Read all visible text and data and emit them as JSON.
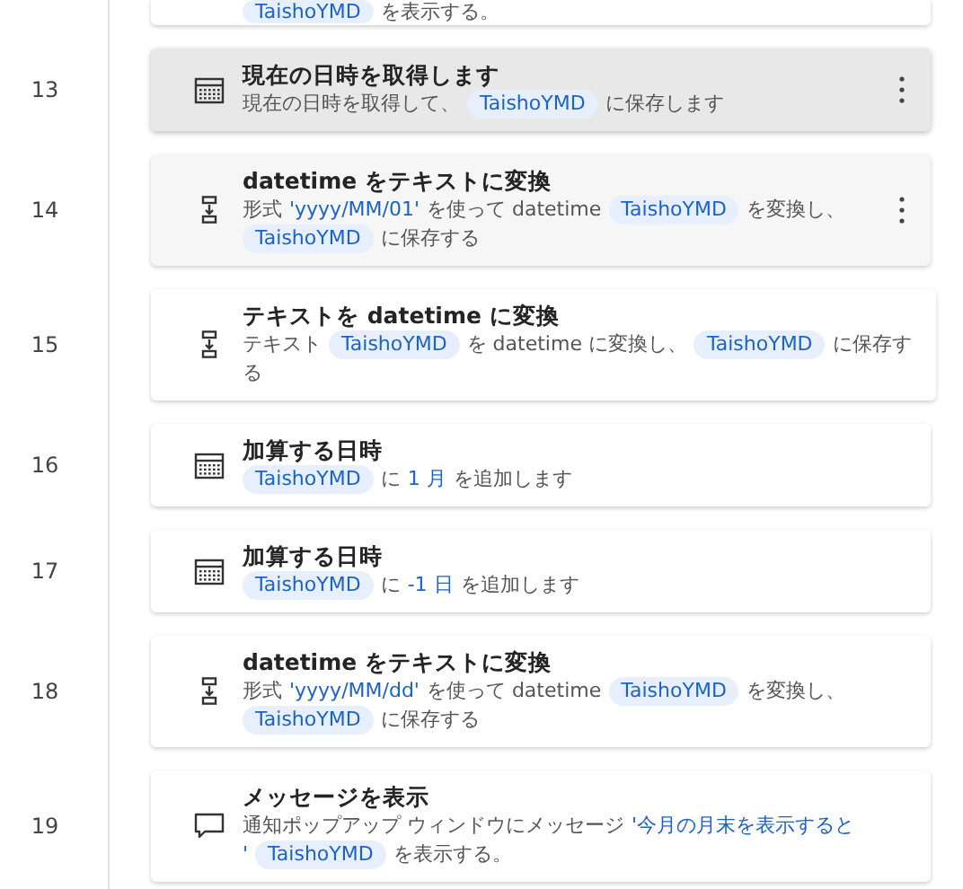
{
  "steps": [
    {
      "kind": "partial",
      "selected": false,
      "hovered": false,
      "lines": [
        [
          {
            "kind": "var",
            "text": "TaishoYMD"
          },
          {
            "kind": "text",
            "text": "を表示する。"
          }
        ]
      ]
    },
    {
      "number": "13",
      "title": "現在の日時を取得します",
      "kind": "calendar",
      "selected": true,
      "hovered": false,
      "lines": [
        [
          {
            "kind": "text",
            "text": "現在の日時を取得して、"
          },
          {
            "kind": "var",
            "text": "TaishoYMD"
          },
          {
            "kind": "text",
            "text": "に保存します"
          }
        ]
      ]
    },
    {
      "number": "14",
      "title": "datetime をテキストに変換",
      "kind": "convert",
      "selected": false,
      "hovered": true,
      "lines": [
        [
          {
            "kind": "text",
            "text": "形式"
          },
          {
            "kind": "literal",
            "text": "'yyyy/MM/01'"
          },
          {
            "kind": "text",
            "text": "を使って datetime"
          },
          {
            "kind": "var",
            "text": "TaishoYMD"
          },
          {
            "kind": "text",
            "text": "を変換し、"
          }
        ],
        [
          {
            "kind": "var",
            "text": "TaishoYMD"
          },
          {
            "kind": "text",
            "text": "に保存する"
          }
        ]
      ]
    },
    {
      "number": "15",
      "title": "テキストを datetime に変換",
      "kind": "convert",
      "selected": false,
      "hovered": false,
      "lines": [
        [
          {
            "kind": "text",
            "text": "テキスト"
          },
          {
            "kind": "var",
            "text": "TaishoYMD"
          },
          {
            "kind": "text",
            "text": "を datetime に変換し、"
          },
          {
            "kind": "var",
            "text": "TaishoYMD"
          },
          {
            "kind": "text",
            "text": "に保存す"
          }
        ],
        [
          {
            "kind": "text",
            "text": "る"
          }
        ]
      ]
    },
    {
      "number": "16",
      "title": "加算する日時",
      "kind": "calendar",
      "selected": false,
      "hovered": false,
      "lines": [
        [
          {
            "kind": "var",
            "text": "TaishoYMD"
          },
          {
            "kind": "text",
            "text": "に"
          },
          {
            "kind": "literal",
            "text": "1 月"
          },
          {
            "kind": "text",
            "text": "を追加します"
          }
        ]
      ]
    },
    {
      "number": "17",
      "title": "加算する日時",
      "kind": "calendar",
      "selected": false,
      "hovered": false,
      "lines": [
        [
          {
            "kind": "var",
            "text": "TaishoYMD"
          },
          {
            "kind": "text",
            "text": "に"
          },
          {
            "kind": "literal",
            "text": "-1 日"
          },
          {
            "kind": "text",
            "text": "を追加します"
          }
        ]
      ]
    },
    {
      "number": "18",
      "title": "datetime をテキストに変換",
      "kind": "convert",
      "selected": false,
      "hovered": false,
      "lines": [
        [
          {
            "kind": "text",
            "text": "形式"
          },
          {
            "kind": "literal",
            "text": "'yyyy/MM/dd'"
          },
          {
            "kind": "text",
            "text": "を使って datetime"
          },
          {
            "kind": "var",
            "text": "TaishoYMD"
          },
          {
            "kind": "text",
            "text": "を変換し、"
          }
        ],
        [
          {
            "kind": "var",
            "text": "TaishoYMD"
          },
          {
            "kind": "text",
            "text": "に保存する"
          }
        ]
      ]
    },
    {
      "number": "19",
      "title": "メッセージを表示",
      "kind": "message",
      "selected": false,
      "hovered": false,
      "lines": [
        [
          {
            "kind": "text",
            "text": "通知ポップアップ ウィンドウにメッセージ"
          },
          {
            "kind": "literal",
            "text": "'今月の月末を表示すると"
          }
        ],
        [
          {
            "kind": "literal",
            "text": "'"
          },
          {
            "kind": "var",
            "text": "TaishoYMD"
          },
          {
            "kind": "text",
            "text": "を表示する。"
          }
        ]
      ]
    }
  ]
}
